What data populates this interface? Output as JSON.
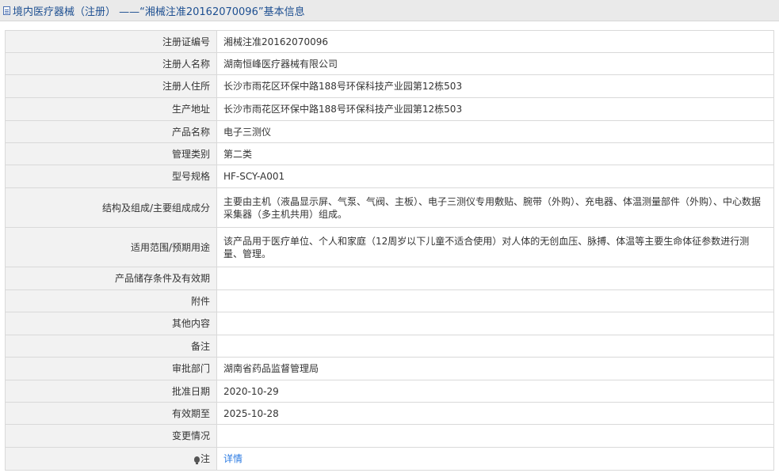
{
  "header": {
    "title": "境内医疗器械（注册） ——“湘械注准20162070096”基本信息"
  },
  "rows": [
    {
      "label": "注册证编号",
      "value": "湘械注准20162070096"
    },
    {
      "label": "注册人名称",
      "value": "湖南恒峰医疗器械有限公司"
    },
    {
      "label": "注册人住所",
      "value": "长沙市雨花区环保中路188号环保科技产业园第12栋503"
    },
    {
      "label": "生产地址",
      "value": "长沙市雨花区环保中路188号环保科技产业园第12栋503"
    },
    {
      "label": "产品名称",
      "value": "电子三测仪"
    },
    {
      "label": "管理类别",
      "value": "第二类"
    },
    {
      "label": "型号规格",
      "value": "HF-SCY-A001"
    },
    {
      "label": "结构及组成/主要组成成分",
      "value": "主要由主机（液晶显示屏、气泵、气阀、主板）、电子三测仪专用敷贴、腕带（外购）、充电器、体温测量部件（外购）、中心数据采集器（多主机共用）组成。"
    },
    {
      "label": "适用范围/预期用途",
      "value": "该产品用于医疗单位、个人和家庭（12周岁以下儿童不适合使用）对人体的无创血压、脉搏、体温等主要生命体征参数进行测量、管理。"
    },
    {
      "label": "产品储存条件及有效期",
      "value": ""
    },
    {
      "label": "附件",
      "value": ""
    },
    {
      "label": "其他内容",
      "value": ""
    },
    {
      "label": "备注",
      "value": ""
    },
    {
      "label": "审批部门",
      "value": "湖南省药品监督管理局"
    },
    {
      "label": "批准日期",
      "value": "2020-10-29"
    },
    {
      "label": "有效期至",
      "value": "2025-10-28"
    },
    {
      "label": "变更情况",
      "value": ""
    },
    {
      "label": "注",
      "value": "详情"
    }
  ]
}
